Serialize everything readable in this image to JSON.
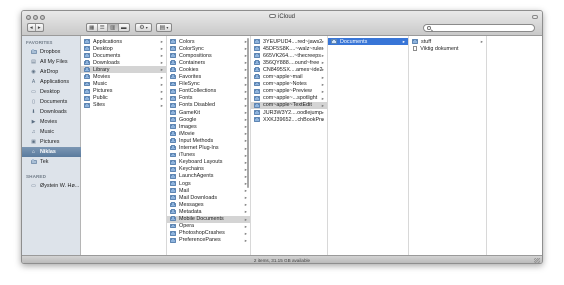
{
  "window": {
    "title": "iCloud",
    "status": "2 items, 31.15 GB available"
  },
  "toolbar": {
    "back_icon": "chevron-left",
    "forward_icon": "chevron-right",
    "view_modes": [
      "icon-view",
      "list-view",
      "column-view",
      "cover-flow-view"
    ],
    "selected_view": "column-view",
    "action_menu": "gear-icon",
    "arrange_menu": "arrange-icon",
    "search": {
      "value": "",
      "placeholder": ""
    }
  },
  "sidebar": {
    "favorites_header": "FAVORITES",
    "favorites": [
      {
        "label": "Dropbox",
        "icon": "folder-icon"
      },
      {
        "label": "All My Files",
        "icon": "all-files-icon"
      },
      {
        "label": "AirDrop",
        "icon": "airdrop-icon"
      },
      {
        "label": "Applications",
        "icon": "applications-icon"
      },
      {
        "label": "Desktop",
        "icon": "desktop-icon"
      },
      {
        "label": "Documents",
        "icon": "documents-icon"
      },
      {
        "label": "Downloads",
        "icon": "downloads-icon"
      },
      {
        "label": "Movies",
        "icon": "movies-icon"
      },
      {
        "label": "Music",
        "icon": "music-icon"
      },
      {
        "label": "Pictures",
        "icon": "pictures-icon"
      },
      {
        "label": "Niklas",
        "icon": "home-icon",
        "selected": true
      },
      {
        "label": "Tek",
        "icon": "folder-icon"
      }
    ],
    "shared_header": "SHARED",
    "shared": [
      {
        "label": "Øystein W. Hø...",
        "icon": "computer-icon"
      }
    ]
  },
  "columns": [
    {
      "items": [
        {
          "label": "Applications",
          "kind": "folder",
          "has_children": true
        },
        {
          "label": "Desktop",
          "kind": "folder",
          "has_children": true
        },
        {
          "label": "Documents",
          "kind": "folder",
          "has_children": true
        },
        {
          "label": "Downloads",
          "kind": "folder",
          "has_children": true
        },
        {
          "label": "Library",
          "kind": "folder",
          "has_children": true,
          "selected": "gray"
        },
        {
          "label": "Movies",
          "kind": "folder",
          "has_children": true
        },
        {
          "label": "Music",
          "kind": "folder",
          "has_children": true
        },
        {
          "label": "Pictures",
          "kind": "folder",
          "has_children": true
        },
        {
          "label": "Public",
          "kind": "folder",
          "has_children": true
        },
        {
          "label": "Sites",
          "kind": "folder",
          "has_children": true
        }
      ]
    },
    {
      "items": [
        {
          "label": "Colors",
          "kind": "folder",
          "has_children": true
        },
        {
          "label": "ColorSync",
          "kind": "folder",
          "has_children": true
        },
        {
          "label": "Compositions",
          "kind": "folder",
          "has_children": true
        },
        {
          "label": "Containers",
          "kind": "folder",
          "has_children": true
        },
        {
          "label": "Cookies",
          "kind": "folder",
          "has_children": true
        },
        {
          "label": "Favorites",
          "kind": "folder",
          "has_children": true
        },
        {
          "label": "FileSync",
          "kind": "folder",
          "has_children": true
        },
        {
          "label": "FontCollections",
          "kind": "folder",
          "has_children": true
        },
        {
          "label": "Fonts",
          "kind": "folder",
          "has_children": true
        },
        {
          "label": "Fonts Disabled",
          "kind": "folder",
          "has_children": true
        },
        {
          "label": "GameKit",
          "kind": "folder",
          "has_children": true
        },
        {
          "label": "Google",
          "kind": "folder",
          "has_children": true
        },
        {
          "label": "Images",
          "kind": "folder",
          "has_children": true
        },
        {
          "label": "iMovie",
          "kind": "folder",
          "has_children": true
        },
        {
          "label": "Input Methods",
          "kind": "folder",
          "has_children": true
        },
        {
          "label": "Internet Plug-Ins",
          "kind": "folder",
          "has_children": true
        },
        {
          "label": "iTunes",
          "kind": "folder",
          "has_children": true
        },
        {
          "label": "Keyboard Layouts",
          "kind": "folder",
          "has_children": true
        },
        {
          "label": "Keychains",
          "kind": "folder",
          "has_children": true
        },
        {
          "label": "LaunchAgents",
          "kind": "folder",
          "has_children": true
        },
        {
          "label": "Logs",
          "kind": "folder",
          "has_children": true
        },
        {
          "label": "Mail",
          "kind": "folder",
          "has_children": true
        },
        {
          "label": "Mail Downloads",
          "kind": "folder",
          "has_children": true
        },
        {
          "label": "Messages",
          "kind": "folder",
          "has_children": true
        },
        {
          "label": "Metadata",
          "kind": "folder",
          "has_children": true
        },
        {
          "label": "Mobile Documents",
          "kind": "folder",
          "has_children": true,
          "selected": "gray"
        },
        {
          "label": "Opera",
          "kind": "folder",
          "has_children": true
        },
        {
          "label": "PhotoshopCrashes",
          "kind": "folder",
          "has_children": true
        },
        {
          "label": "PreferencePanes",
          "kind": "folder",
          "has_children": true
        }
      ]
    },
    {
      "items": [
        {
          "label": "3YEUPUD4....red~jaws2",
          "kind": "folder",
          "has_children": true
        },
        {
          "label": "45DF5S8K....~walz~ruler",
          "kind": "folder",
          "has_children": true
        },
        {
          "label": "665VK264....~thecreeps",
          "kind": "folder",
          "has_children": true
        },
        {
          "label": "356QY888....ound~free",
          "kind": "folder",
          "has_children": true
        },
        {
          "label": "CN8495SX....ames~ide2",
          "kind": "folder",
          "has_children": true
        },
        {
          "label": "com~apple~mail",
          "kind": "folder",
          "has_children": true
        },
        {
          "label": "com~apple~Notes",
          "kind": "folder",
          "has_children": true
        },
        {
          "label": "com~apple~Preview",
          "kind": "folder",
          "has_children": true
        },
        {
          "label": "com~apple~...spotlight",
          "kind": "folder",
          "has_children": true
        },
        {
          "label": "com~apple~TextEdit",
          "kind": "folder",
          "has_children": true,
          "selected": "gray"
        },
        {
          "label": "JUR3W3Y2....oodlejump",
          "kind": "folder",
          "has_children": true
        },
        {
          "label": "XXKJ39652....chBookPro",
          "kind": "folder",
          "has_children": true
        }
      ]
    },
    {
      "items": [
        {
          "label": "Documents",
          "kind": "folder",
          "has_children": true,
          "selected": "blue"
        }
      ]
    },
    {
      "items": [
        {
          "label": "stuff",
          "kind": "folder",
          "has_children": true
        },
        {
          "label": "Viktig dokument",
          "kind": "document",
          "has_children": false
        }
      ]
    }
  ],
  "colors": {
    "selection_blue": "#3875d7",
    "selection_gray": "#d4d4d4",
    "sidebar_bg": "#dde3ea",
    "sidebar_selected": "#5a7b9e"
  }
}
